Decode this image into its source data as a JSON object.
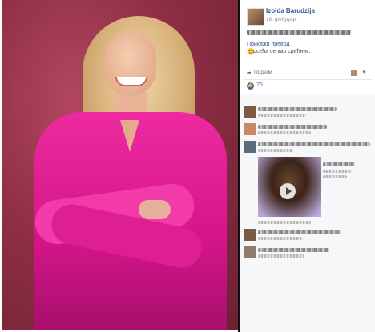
{
  "post": {
    "author": "Izolda Barudzija",
    "date": "18. фебруар ·",
    "translation_label": "Прикажи превод",
    "translation_text": "осећа се као срећник."
  },
  "actions": {
    "share_label": "Подели"
  },
  "reactions": {
    "count": "75"
  },
  "icons": [
    "share-icon",
    "like-icon",
    "chevron-down-icon",
    "play-icon",
    "emoji-icon"
  ],
  "colors": {
    "accent": "#365899",
    "like": "#4267b2",
    "panel_bg": "#ffffff",
    "comments_bg": "#f6f7f9",
    "photo_bg": "#8f2f44",
    "dress": "#e01f92"
  }
}
